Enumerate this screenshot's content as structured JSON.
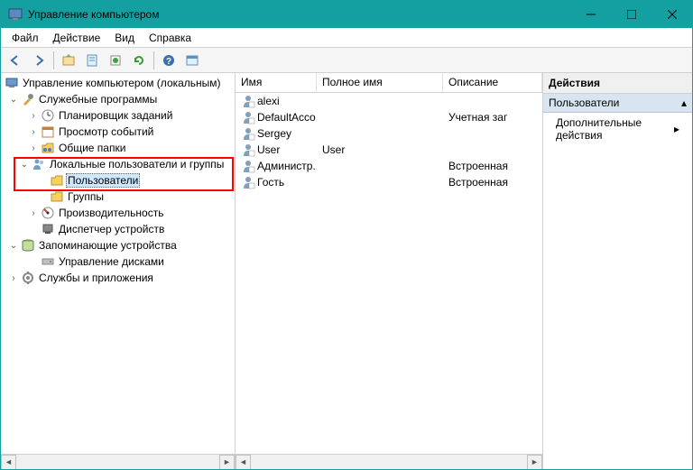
{
  "window": {
    "title": "Управление компьютером"
  },
  "menu": {
    "file": "Файл",
    "action": "Действие",
    "view": "Вид",
    "help": "Справка"
  },
  "tree": {
    "root": "Управление компьютером (локальным)",
    "system_tools": "Служебные программы",
    "task_scheduler": "Планировщик заданий",
    "event_viewer": "Просмотр событий",
    "shared_folders": "Общие папки",
    "local_users": "Локальные пользователи и группы",
    "users": "Пользователи",
    "groups": "Группы",
    "performance": "Производительность",
    "device_manager": "Диспетчер устройств",
    "storage": "Запоминающие устройства",
    "disk_management": "Управление дисками",
    "services": "Службы и приложения"
  },
  "columns": {
    "name": "Имя",
    "full_name": "Полное имя",
    "description": "Описание"
  },
  "users": [
    {
      "name": "alexi",
      "full_name": "",
      "description": ""
    },
    {
      "name": "DefaultAcco...",
      "full_name": "",
      "description": "Учетная заг"
    },
    {
      "name": "Sergey",
      "full_name": "",
      "description": ""
    },
    {
      "name": "User",
      "full_name": "User",
      "description": ""
    },
    {
      "name": "Администр...",
      "full_name": "",
      "description": "Встроенная"
    },
    {
      "name": "Гость",
      "full_name": "",
      "description": "Встроенная"
    }
  ],
  "actions": {
    "header": "Действия",
    "section": "Пользователи",
    "more": "Дополнительные действия"
  }
}
